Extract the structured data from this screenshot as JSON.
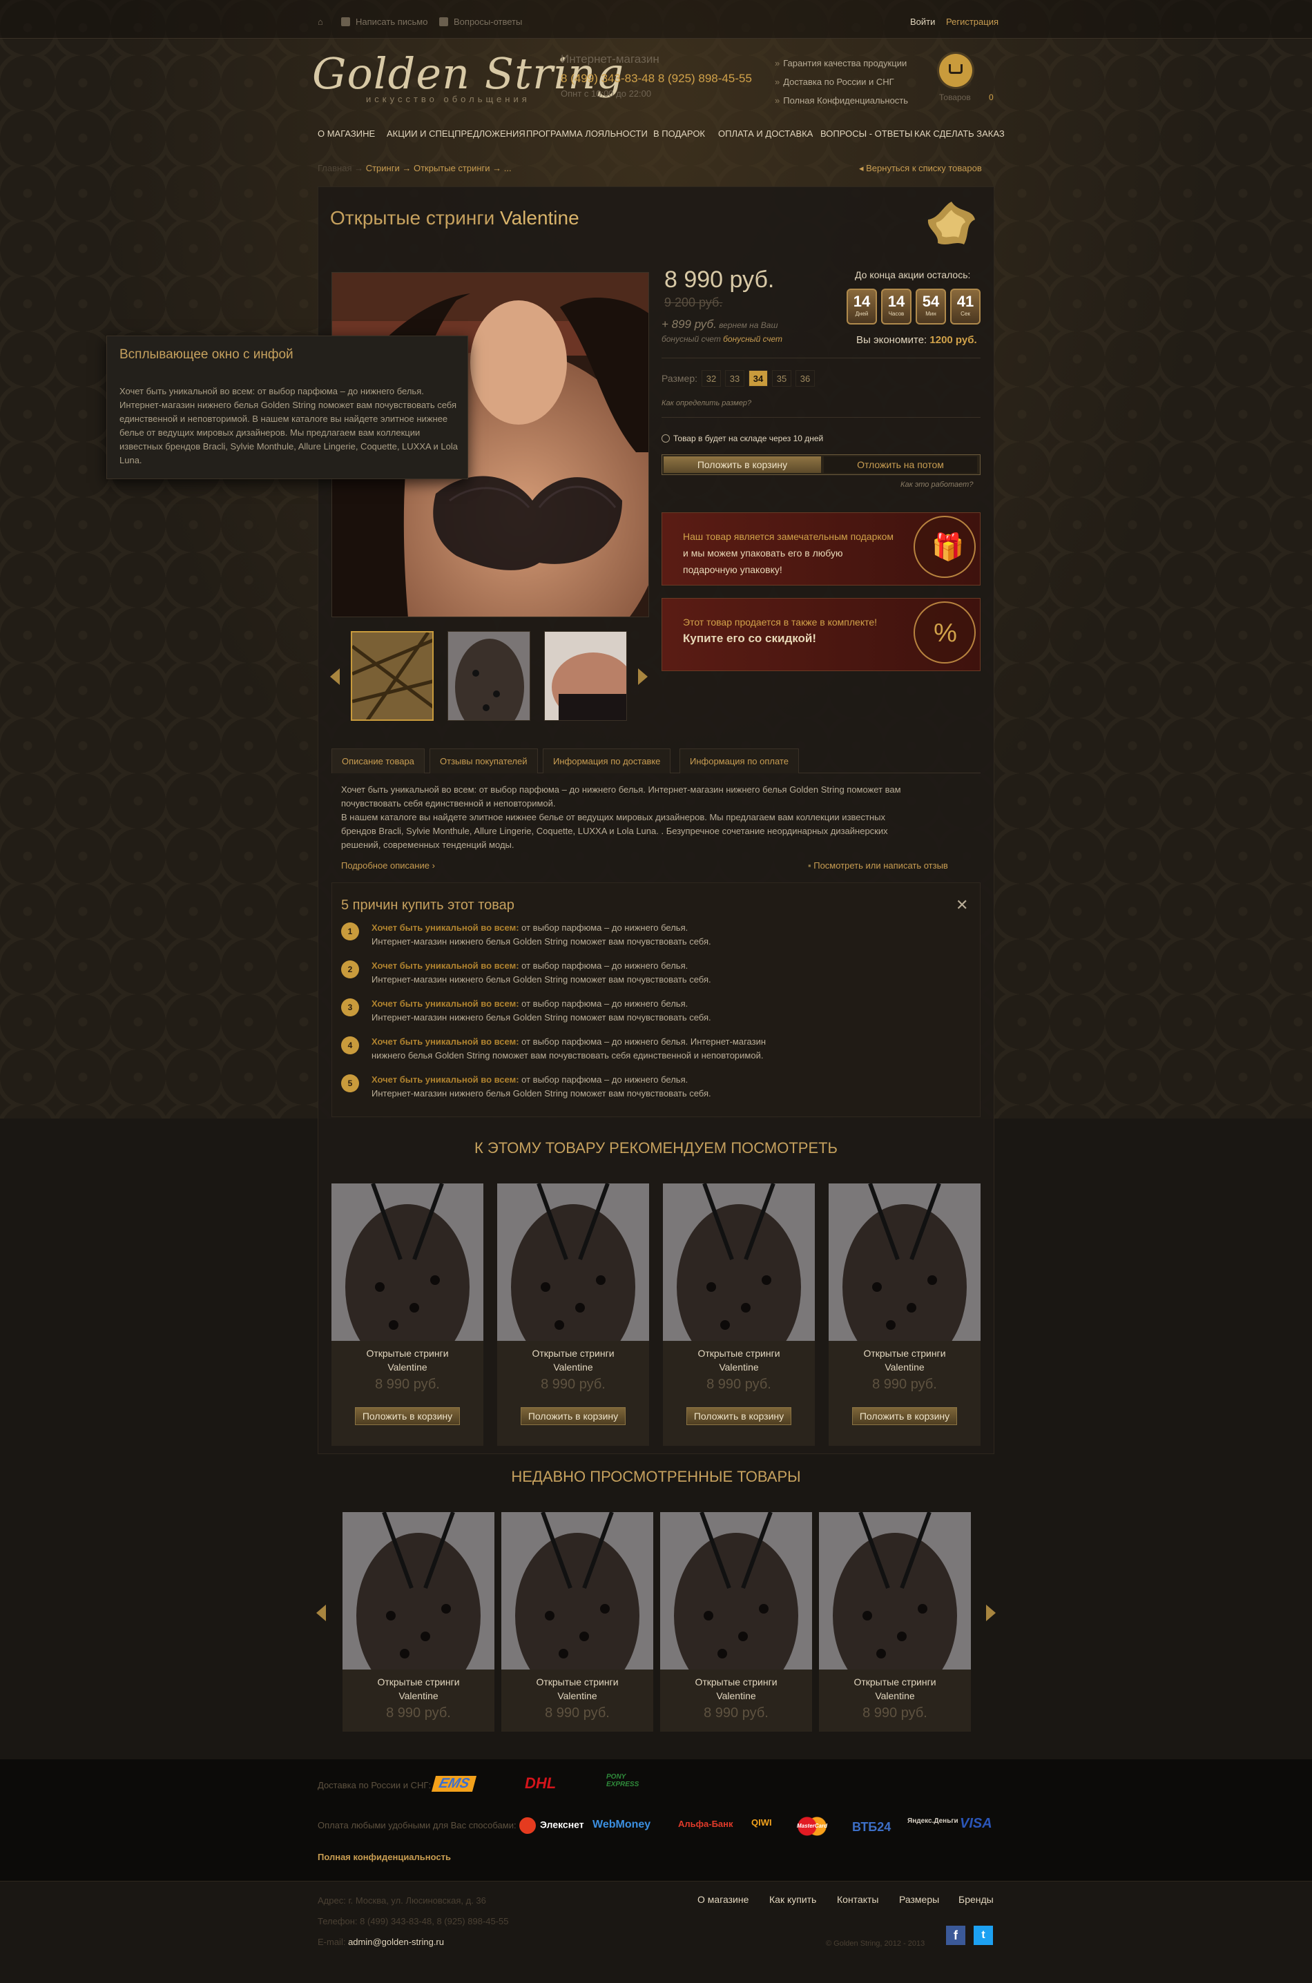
{
  "topbar": {
    "write": "Написать письмо",
    "faq": "Вопросы-ответы",
    "login": "Войти",
    "register": "Регистрация"
  },
  "header": {
    "logo_main": "Golden String",
    "logo_sub": "искусство обольщения",
    "shop_label": "Интернет-магазин",
    "phones": "8 (499) 343-83-48   8 (925) 898-45-55",
    "hours": "Опнт с 10:00 до 22:00",
    "features": [
      "Гарантия качества продукции",
      "Доставка по России и СНГ",
      "Полная Конфиденциальность"
    ],
    "cart_label": "Товаров",
    "cart_count": "0"
  },
  "nav": [
    "О МАГАЗИНЕ",
    "АКЦИИ И СПЕЦПРЕДЛОЖЕНИЯ",
    "ПРОГРАММА ЛОЯЛЬНОСТИ",
    "В ПОДАРОК",
    "ОПЛАТА И ДОСТАВКА",
    "ВОПРОСЫ - ОТВЕТЫ",
    "КАК СДЕЛАТЬ ЗАКАЗ"
  ],
  "breadcrumb": {
    "home": "Главная →",
    "cat": "Стринги → Открытые стринги → ...",
    "back": "Вернуться к списку товаров"
  },
  "product": {
    "title_a": "Открытые стринги ",
    "title_b": "Valentine",
    "price": "8 990 руб.",
    "old_price": "9 200 руб.",
    "bonus_amount": "+ 899 руб.",
    "bonus_text1": " вернем на Ваш",
    "bonus_text2": "бонусный счет ",
    "bonus_link": "бонусный счет",
    "timer_title": "До конца акции осталось:",
    "timer": [
      {
        "n": "14",
        "u": "Дней"
      },
      {
        "n": "14",
        "u": "Часов"
      },
      {
        "n": "54",
        "u": "Мин"
      },
      {
        "n": "41",
        "u": "Сек"
      }
    ],
    "save_text": "Вы экономите: ",
    "save_value": "1200 руб.",
    "size_label": "Размер:",
    "sizes": [
      "32",
      "33",
      "34",
      "35",
      "36"
    ],
    "size_selected": "34",
    "size_help": "Как определить размер?",
    "in_basket": "Товар в будет на складе через 10 дней",
    "btn_cart": "Положить в корзину",
    "btn_later": "Отложить на потом",
    "how_works": "Как это работает?",
    "promo1_a": "Наш товар является замечательным подарком",
    "promo1_b": "и мы можем упаковать его в любую",
    "promo1_c": "подарочную упаковку!",
    "promo2_a": "Этот товар продается в также в комплекте!",
    "promo2_b": "Купите его со скидкой!"
  },
  "popup": {
    "title": "Всплывающее окно с инфой",
    "text": "Хочет быть уникальной во всем: от выбор парфюма – до нижнего белья. Интернет-магазин нижнего белья Golden String поможет вам почувствовать себя единственной и неповторимой. В нашем каталоге вы найдете элитное нижнее белье от ведущих мировых дизайнеров. Мы предлагаем вам коллекции известных брендов Bracli, Sylvie Monthule, Allure Lingerie, Coquette, LUXXA и Lola Luna."
  },
  "tabs": [
    "Описание товара",
    "Отзывы покупателей",
    "Информация по доставке",
    "Информация по оплате"
  ],
  "description": {
    "l1": "Хочет быть уникальной во всем: от выбор парфюма – до нижнего белья. Интернет-магазин нижнего белья Golden String поможет вам",
    "l2": "почувствовать себя единственной и неповторимой.",
    "l3": "В нашем каталоге вы найдете элитное нижнее белье от ведущих мировых дизайнеров. Мы предлагаем вам коллекции известных",
    "l4": "брендов Bracli, Sylvie Monthule, Allure Lingerie, Coquette, LUXXA и Lola Luna. . Безупречное сочетание неординарных дизайнерских",
    "l5": "решений, современных тенденций моды.",
    "more": "Подробное описание",
    "review": "Посмотреть или написать отзыв"
  },
  "reasons": {
    "title": "5 причин купить этот товар",
    "items": [
      {
        "n": "1",
        "b": "Хочет быть уникальной во всем:",
        "t1": " от выбор парфюма – до нижнего белья.",
        "t2": "Интернет-магазин нижнего белья Golden String поможет вам почувствовать себя."
      },
      {
        "n": "2",
        "b": "Хочет быть уникальной во всем:",
        "t1": " от выбор парфюма – до нижнего белья.",
        "t2": "Интернет-магазин нижнего белья Golden String поможет вам почувствовать себя."
      },
      {
        "n": "3",
        "b": "Хочет быть уникальной во всем:",
        "t1": " от выбор парфюма – до нижнего белья.",
        "t2": "Интернет-магазин нижнего белья Golden String поможет вам почувствовать себя."
      },
      {
        "n": "4",
        "b": "Хочет быть уникальной во всем:",
        "t1": " от выбор парфюма – до нижнего белья. Интернет-магазин",
        "t2": "нижнего белья Golden String поможет вам почувствовать себя единственной и неповторимой."
      },
      {
        "n": "5",
        "b": "Хочет быть уникальной во всем:",
        "t1": " от выбор парфюма – до нижнего белья.",
        "t2": "Интернет-магазин нижнего белья Golden String поможет вам почувствовать себя."
      }
    ]
  },
  "recommend": {
    "title": "К ЭТОМУ ТОВАРУ РЕКОМЕНДУЕМ ПОСМОТРЕТЬ",
    "items": [
      {
        "n1": "Открытые стринги",
        "n2": "Valentine",
        "price": "8 990 руб.",
        "btn": "Положить в корзину"
      },
      {
        "n1": "Открытые стринги",
        "n2": "Valentine",
        "price": "8 990 руб.",
        "btn": "Положить в корзину"
      },
      {
        "n1": "Открытые стринги",
        "n2": "Valentine",
        "price": "8 990 руб.",
        "btn": "Положить в корзину"
      },
      {
        "n1": "Открытые стринги",
        "n2": "Valentine",
        "price": "8 990 руб.",
        "btn": "Положить в корзину"
      }
    ]
  },
  "recent": {
    "title": "НЕДАВНО ПРОСМОТРЕННЫЕ ТОВАРЫ",
    "items": [
      {
        "n1": "Открытые стринги",
        "n2": "Valentine",
        "price": "8 990 руб."
      },
      {
        "n1": "Открытые стринги",
        "n2": "Valentine",
        "price": "8 990 руб."
      },
      {
        "n1": "Открытые стринги",
        "n2": "Valentine",
        "price": "8 990 руб."
      },
      {
        "n1": "Открытые стринги",
        "n2": "Valentine",
        "price": "8 990 руб."
      }
    ]
  },
  "footer": {
    "delivery": "Доставка по России и СНГ:",
    "delivery_logos": [
      "EMS",
      "DHL",
      "PONY EXPRESS"
    ],
    "payment": "Оплата любыми удобными для Вас способами:",
    "payment_logos": [
      "Элекснет",
      "WebMoney",
      "Альфа-Банк",
      "QIWI",
      "MasterCard",
      "ВТБ24",
      "Яндекс.Деньги",
      "VISA"
    ],
    "privacy": "Полная конфиденциальность",
    "address": "Адрес: г. Москва, ул. Люсиновская, д. 36",
    "phone": "Телефон: 8 (499) 343-83-48, 8 (925) 898-45-55",
    "email_label": "E-mail: ",
    "email": "admin@golden-string.ru",
    "links": [
      "О магазине",
      "Как купить",
      "Контакты",
      "Размеры",
      "Бренды"
    ],
    "copyright": "© Golden String, 2012 - 2013"
  }
}
